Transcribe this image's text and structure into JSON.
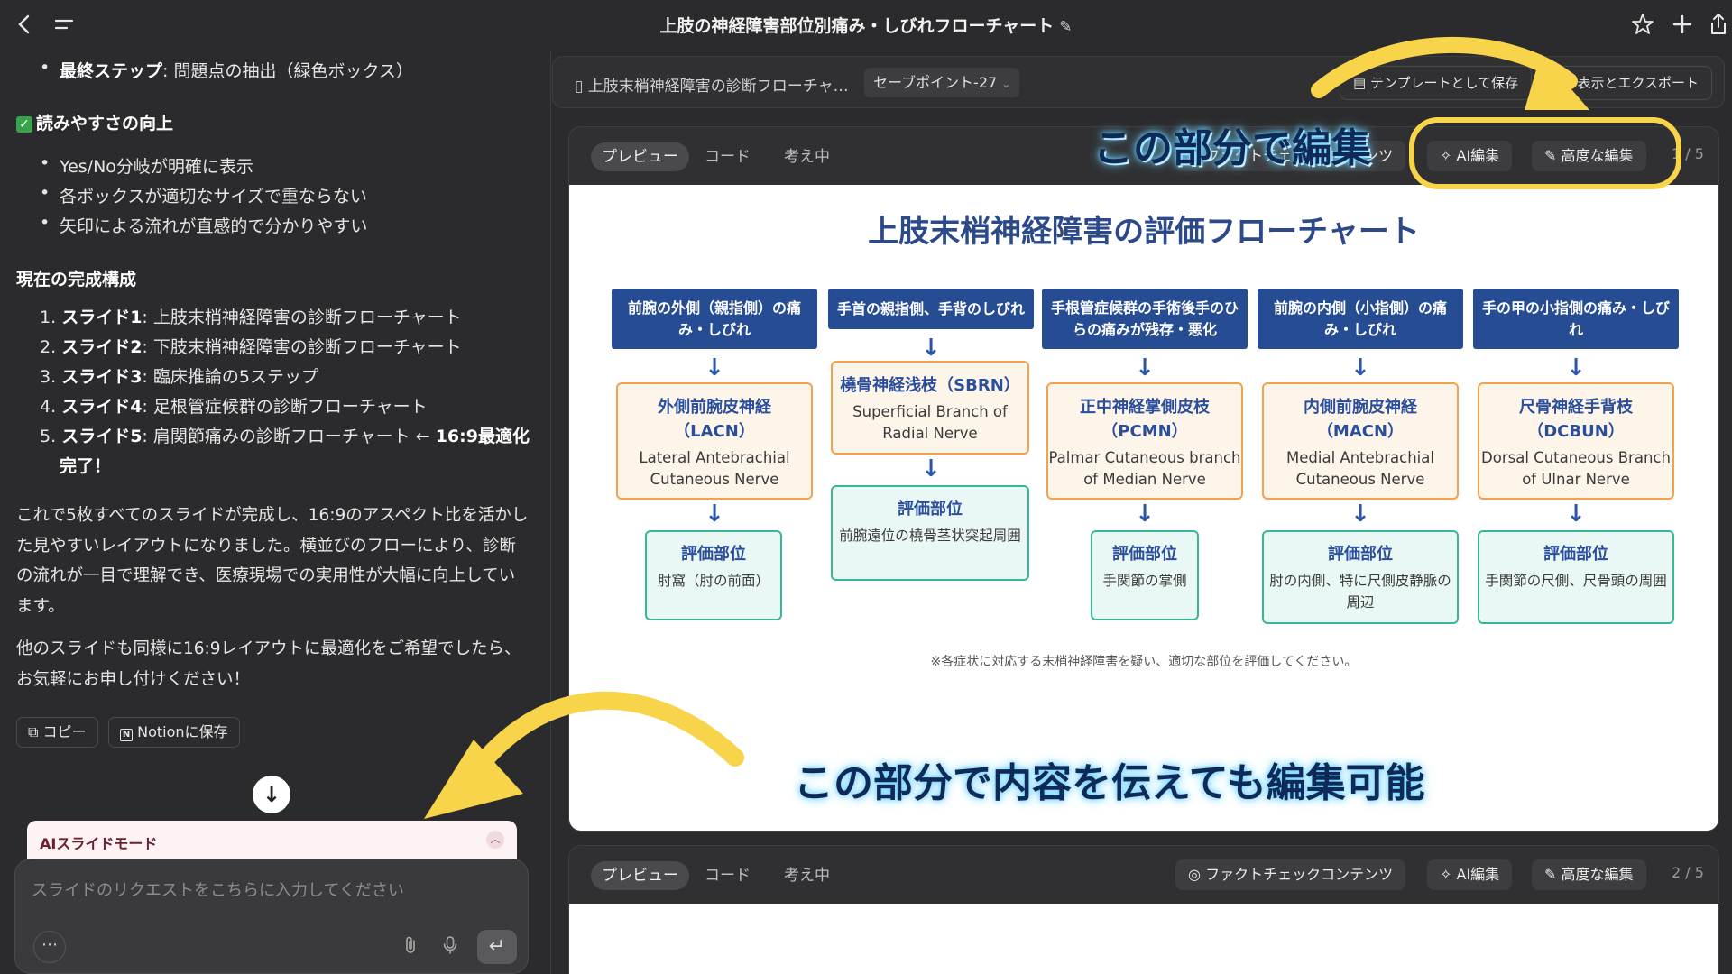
{
  "topbar": {
    "back_icon": "chevron-left-icon",
    "menu_icon": "menu-icon",
    "title": "上肢の神経障害部位別痛み・しびれフローチャート",
    "edit_icon": "✎",
    "star_icon": "☆",
    "plus_icon": "+",
    "share_icon": "share-icon"
  },
  "chat": {
    "final_step_label": "最終ステップ",
    "final_step_text": ": 問題点の抽出（緑色ボックス）",
    "readability_heading": "読みやすさの向上",
    "readability_items": [
      "Yes/No分岐が明確に表示",
      "各ボックスが適切なサイズで重ならない",
      "矢印による流れが直感的で分かりやすい"
    ],
    "current_heading": "現在の完成構成",
    "slides": [
      {
        "num": "1.",
        "label": "スライド1",
        "text": ": 上肢末梢神経障害の診断フローチャート"
      },
      {
        "num": "2.",
        "label": "スライド2",
        "text": ": 下肢末梢神経障害の診断フローチャート"
      },
      {
        "num": "3.",
        "label": "スライド3",
        "text": ": 臨床推論の5ステップ"
      },
      {
        "num": "4.",
        "label": "スライド4",
        "text": ": 足根管症候群の診断フローチャート"
      },
      {
        "num": "5.",
        "label": "スライド5",
        "text": ": 肩関節痛みの診断フローチャート ← ",
        "bold_tail": "16:9最適化",
        "bold_tail2": "完了！"
      }
    ],
    "summary": "これで5枚すべてのスライドが完成し、16:9のアスペクト比を活かした見やすいレイアウトになりました。横並びのフローにより、診断の流れが一目で理解でき、医療現場での実用性が大幅に向上しています。",
    "followup": "他のスライドも同様に16:9レイアウトに最適化をご希望でしたら、お気軽にお申し付けください！",
    "copy_label": "コピー",
    "notion_label": "Notionに保存",
    "ai_mode_label": "AIスライドモード",
    "input_placeholder": "スライドのリクエストをこちらに入力してください"
  },
  "editor": {
    "breadcrumb": "上肢末梢神経障害の診断フローチャ…",
    "savepoint": "セーブポイント-27",
    "template_btn": "テンプレートとして保存",
    "export_btn": "表示とエクスポート",
    "tabs": [
      "プレビュー",
      "コード",
      "考え中"
    ],
    "factcheck": "ファクトチェックコンテンツ",
    "ai_edit": "AI編集",
    "advanced_edit": "高度な編集",
    "page1": "1 / 5",
    "page2": "2 / 5"
  },
  "slide": {
    "title": "上肢末梢神経障害の評価フローチャート",
    "columns": [
      {
        "symptom": "前腕の外側（親指側）の痛み・しびれ",
        "nerve_jp": "外側前腕皮神経（LACN）",
        "nerve_en": "Lateral Antebrachial Cutaneous Nerve",
        "eval_title": "評価部位",
        "eval_body": "肘窩（肘の前面）"
      },
      {
        "symptom": "手首の親指側、手背のしびれ",
        "nerve_jp": "橈骨神経浅枝（SBRN）",
        "nerve_en": "Superficial Branch of Radial Nerve",
        "eval_title": "評価部位",
        "eval_body": "前腕遠位の橈骨茎状突起周囲"
      },
      {
        "symptom": "手根管症候群の手術後手のひらの痛みが残存・悪化",
        "nerve_jp": "正中神経掌側皮枝（PCMN）",
        "nerve_en": "Palmar Cutaneous branch of Median Nerve",
        "eval_title": "評価部位",
        "eval_body": "手関節の掌側"
      },
      {
        "symptom": "前腕の内側（小指側）の痛み・しびれ",
        "nerve_jp": "内側前腕皮神経（MACN）",
        "nerve_en": "Medial Antebrachial Cutaneous Nerve",
        "eval_title": "評価部位",
        "eval_body": "肘の内側、特に尺側皮静脈の周辺"
      },
      {
        "symptom": "手の甲の小指側の痛み・しびれ",
        "nerve_jp": "尺骨神経手背枝（DCBUN）",
        "nerve_en": "Dorsal Cutaneous Branch of Ulnar Nerve",
        "eval_title": "評価部位",
        "eval_body": "手関節の尺側、尺骨頭の周囲"
      }
    ],
    "footnote": "※各症状に対応する末梢神経障害を疑い、適切な部位を評価してください。"
  },
  "annotations": {
    "edit_here": "この部分で編集",
    "convey_here": "この部分で内容を伝えても編集可能",
    "highlight_color": "#f7d44a",
    "text_color": "#0f2a57",
    "glow_color": "#6fd3ff"
  }
}
